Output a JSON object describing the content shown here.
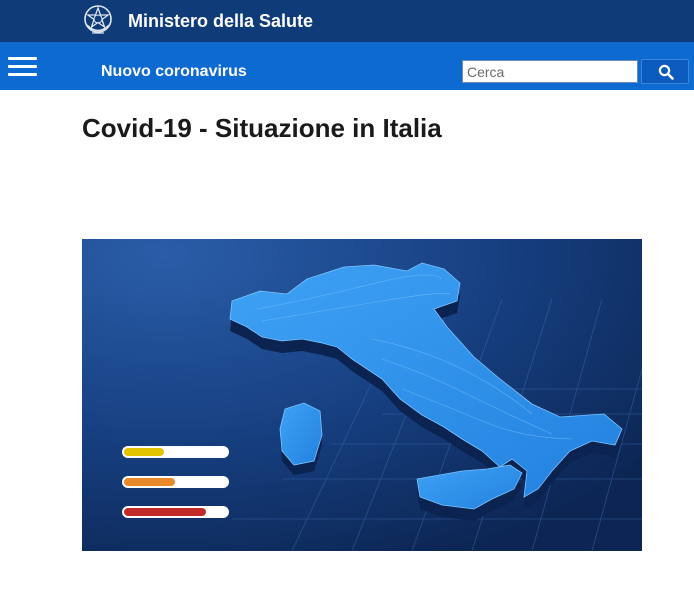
{
  "header": {
    "ministry_name": "Ministero della Salute",
    "emblem_icon": "italian-republic-emblem-icon"
  },
  "navbar": {
    "menu_icon": "hamburger-menu-icon",
    "section_title": "Nuovo coronavirus",
    "search": {
      "placeholder": "Cerca",
      "value": "",
      "button_icon": "search-icon"
    }
  },
  "main": {
    "title": "Covid-19 - Situazione in Italia",
    "hero_image": {
      "description_icon": "italy-map-illustration",
      "level_bars": [
        {
          "color": "#e2c400",
          "fill": 0.38
        },
        {
          "color": "#e8892a",
          "fill": 0.49
        },
        {
          "color": "#c22a2a",
          "fill": 0.79
        }
      ]
    }
  },
  "colors": {
    "topbar": "#0f3b78",
    "navbar": "#0d6ad1",
    "hero_bg": "#123a74"
  }
}
